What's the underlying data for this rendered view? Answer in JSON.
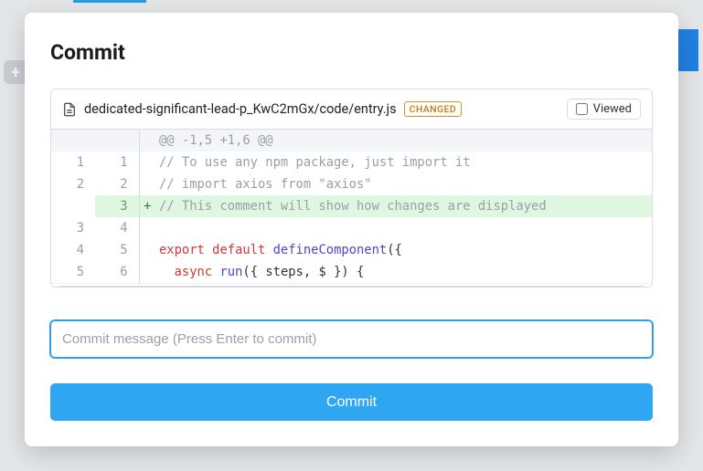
{
  "modal": {
    "title": "Commit",
    "file": {
      "path": "dedicated-significant-lead-p_KwC2mGx/code/entry.js",
      "badge": "CHANGED",
      "viewed_label": "Viewed",
      "viewed_checked": false
    },
    "diff": {
      "hunk": "@@ -1,5 +1,6 @@",
      "rows": [
        {
          "old": "1",
          "new": "1",
          "marker": " ",
          "type": "ctx",
          "tokens": [
            {
              "t": "// To use any npm package, just import it",
              "c": "tok-comment"
            }
          ]
        },
        {
          "old": "2",
          "new": "2",
          "marker": " ",
          "type": "ctx",
          "tokens": [
            {
              "t": "// import axios from \"axios\"",
              "c": "tok-comment"
            }
          ]
        },
        {
          "old": "",
          "new": "3",
          "marker": "+",
          "type": "add",
          "tokens": [
            {
              "t": "// This comment will show how changes are displayed",
              "c": "tok-comment"
            }
          ]
        },
        {
          "old": "3",
          "new": "4",
          "marker": " ",
          "type": "ctx",
          "tokens": [
            {
              "t": "",
              "c": "tok-plain"
            }
          ]
        },
        {
          "old": "4",
          "new": "5",
          "marker": " ",
          "type": "ctx",
          "tokens": [
            {
              "t": "export",
              "c": "tok-kw-red"
            },
            {
              "t": " ",
              "c": "tok-plain"
            },
            {
              "t": "default",
              "c": "tok-kw-red"
            },
            {
              "t": " ",
              "c": "tok-plain"
            },
            {
              "t": "defineComponent",
              "c": "tok-fn"
            },
            {
              "t": "({",
              "c": "tok-plain"
            }
          ]
        },
        {
          "old": "5",
          "new": "6",
          "marker": " ",
          "type": "ctx",
          "tokens": [
            {
              "t": "  ",
              "c": "tok-plain"
            },
            {
              "t": "async",
              "c": "tok-kw-red"
            },
            {
              "t": " ",
              "c": "tok-plain"
            },
            {
              "t": "run",
              "c": "tok-fn"
            },
            {
              "t": "({ steps, $ }) {",
              "c": "tok-plain"
            }
          ]
        }
      ]
    },
    "input_placeholder": "Commit message (Press Enter to commit)",
    "input_value": "",
    "button_label": "Commit"
  }
}
